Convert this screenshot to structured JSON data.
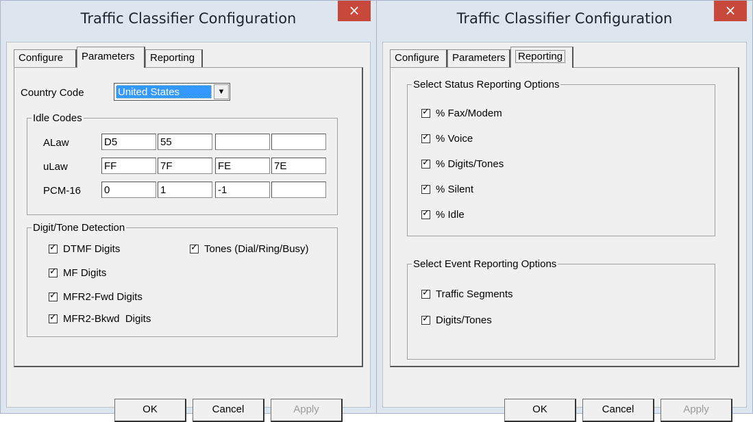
{
  "left_dialog": {
    "title": "Traffic Classifier Configuration",
    "close_glyph": "×",
    "tabs": [
      {
        "label": "Configure",
        "active": false
      },
      {
        "label": "Parameters",
        "active": true
      },
      {
        "label": "Reporting",
        "active": false
      }
    ],
    "country_code": {
      "label": "Country Code",
      "value": "United States"
    },
    "idle_codes": {
      "legend": "Idle Codes",
      "rows": [
        {
          "label": "ALaw",
          "values": [
            "D5",
            "55",
            "",
            ""
          ]
        },
        {
          "label": "uLaw",
          "values": [
            "FF",
            "7F",
            "FE",
            "7E"
          ]
        },
        {
          "label": "PCM-16",
          "values": [
            "0",
            "1",
            "-1",
            ""
          ]
        }
      ]
    },
    "detection": {
      "legend": "Digit/Tone Detection",
      "items": [
        {
          "label": "DTMF Digits",
          "checked": true
        },
        {
          "label": "MF Digits",
          "checked": true
        },
        {
          "label": "MFR2-Fwd Digits",
          "checked": true
        },
        {
          "label": "MFR2-Bkwd  Digits",
          "checked": true
        },
        {
          "label": "Tones (Dial/Ring/Busy)",
          "checked": true
        }
      ]
    },
    "buttons": {
      "ok": "OK",
      "cancel": "Cancel",
      "apply": "Apply"
    }
  },
  "right_dialog": {
    "title": "Traffic Classifier Configuration",
    "close_glyph": "×",
    "tabs": [
      {
        "label": "Configure",
        "active": false
      },
      {
        "label": "Parameters",
        "active": false
      },
      {
        "label": "Reporting",
        "active": true
      }
    ],
    "status_group": {
      "legend": "Select Status Reporting Options",
      "items": [
        {
          "label": "% Fax/Modem",
          "checked": true
        },
        {
          "label": "% Voice",
          "checked": true
        },
        {
          "label": "% Digits/Tones",
          "checked": true
        },
        {
          "label": "% Silent",
          "checked": true
        },
        {
          "label": "% Idle",
          "checked": true
        }
      ]
    },
    "event_group": {
      "legend": "Select Event Reporting Options",
      "items": [
        {
          "label": "Traffic Segments",
          "checked": true
        },
        {
          "label": "Digits/Tones",
          "checked": true
        }
      ]
    },
    "buttons": {
      "ok": "OK",
      "cancel": "Cancel",
      "apply": "Apply"
    }
  }
}
